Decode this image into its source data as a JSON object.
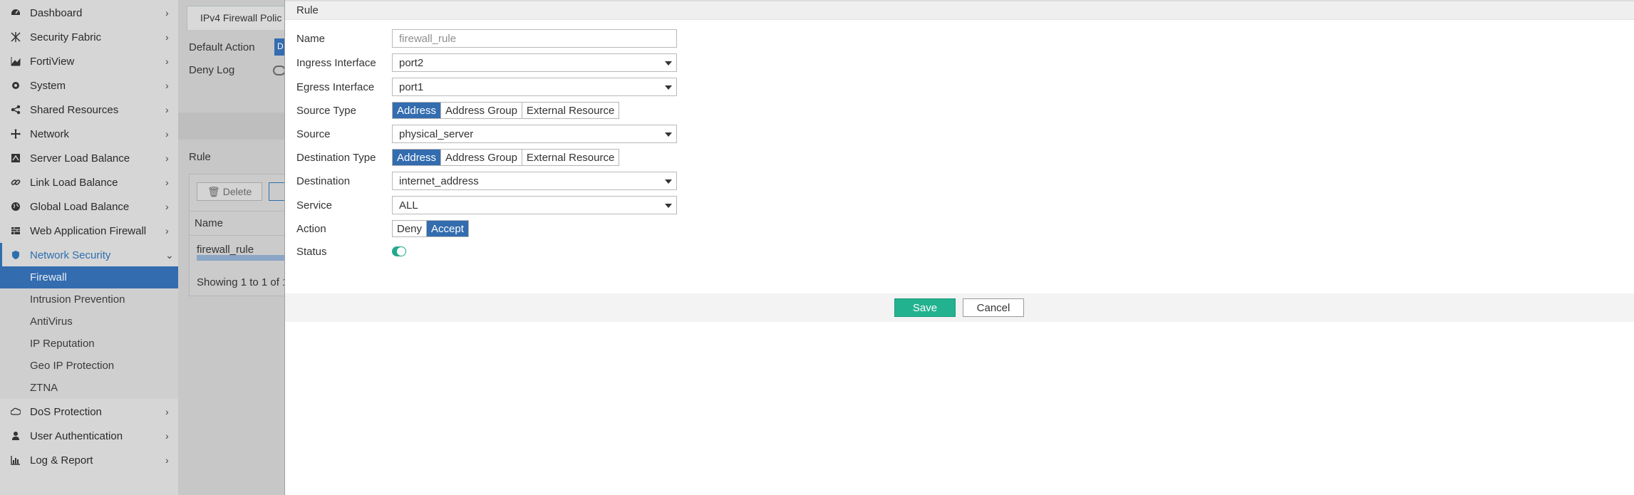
{
  "sidebar": {
    "items": [
      {
        "label": "Dashboard",
        "icon": "dashboard-icon"
      },
      {
        "label": "Security Fabric",
        "icon": "security-fabric-icon"
      },
      {
        "label": "FortiView",
        "icon": "chart-icon"
      },
      {
        "label": "System",
        "icon": "gear-icon"
      },
      {
        "label": "Shared Resources",
        "icon": "share-icon"
      },
      {
        "label": "Network",
        "icon": "network-icon"
      },
      {
        "label": "Server Load Balance",
        "icon": "server-balance-icon"
      },
      {
        "label": "Link Load Balance",
        "icon": "link-icon"
      },
      {
        "label": "Global Load Balance",
        "icon": "globe-icon"
      },
      {
        "label": "Web Application Firewall",
        "icon": "waf-icon"
      },
      {
        "label": "Network Security",
        "icon": "shield-icon"
      }
    ],
    "network_security_sub": [
      "Firewall",
      "Intrusion Prevention",
      "AntiVirus",
      "IP Reputation",
      "Geo IP Protection",
      "ZTNA"
    ],
    "bottom_items": [
      {
        "label": "DoS Protection",
        "icon": "cloud-icon"
      },
      {
        "label": "User Authentication",
        "icon": "user-icon"
      },
      {
        "label": "Log & Report",
        "icon": "bar-chart-icon"
      }
    ]
  },
  "background": {
    "tab_label": "IPv4 Firewall Polic",
    "default_action_label": "Default Action",
    "default_action_value": "D",
    "deny_log_label": "Deny Log",
    "rule_section": "Rule",
    "delete_label": "Delete",
    "col_name": "Name",
    "row_name": "firewall_rule",
    "showing": "Showing 1 to 1 of 1"
  },
  "modal": {
    "title": "Rule",
    "name_label": "Name",
    "name_placeholder": "firewall_rule",
    "ingress_label": "Ingress Interface",
    "ingress_value": "port2",
    "egress_label": "Egress Interface",
    "egress_value": "port1",
    "source_type_label": "Source Type",
    "type_options": [
      "Address",
      "Address Group",
      "External Resource"
    ],
    "source_label": "Source",
    "source_value": "physical_server",
    "dest_type_label": "Destination Type",
    "dest_label": "Destination",
    "dest_value": "internet_address",
    "service_label": "Service",
    "service_value": "ALL",
    "action_label": "Action",
    "action_options": [
      "Deny",
      "Accept"
    ],
    "status_label": "Status",
    "save_label": "Save",
    "cancel_label": "Cancel"
  },
  "colors": {
    "accent": "#336caf",
    "save": "#23b28f",
    "toggle_on": "#24a88b"
  }
}
